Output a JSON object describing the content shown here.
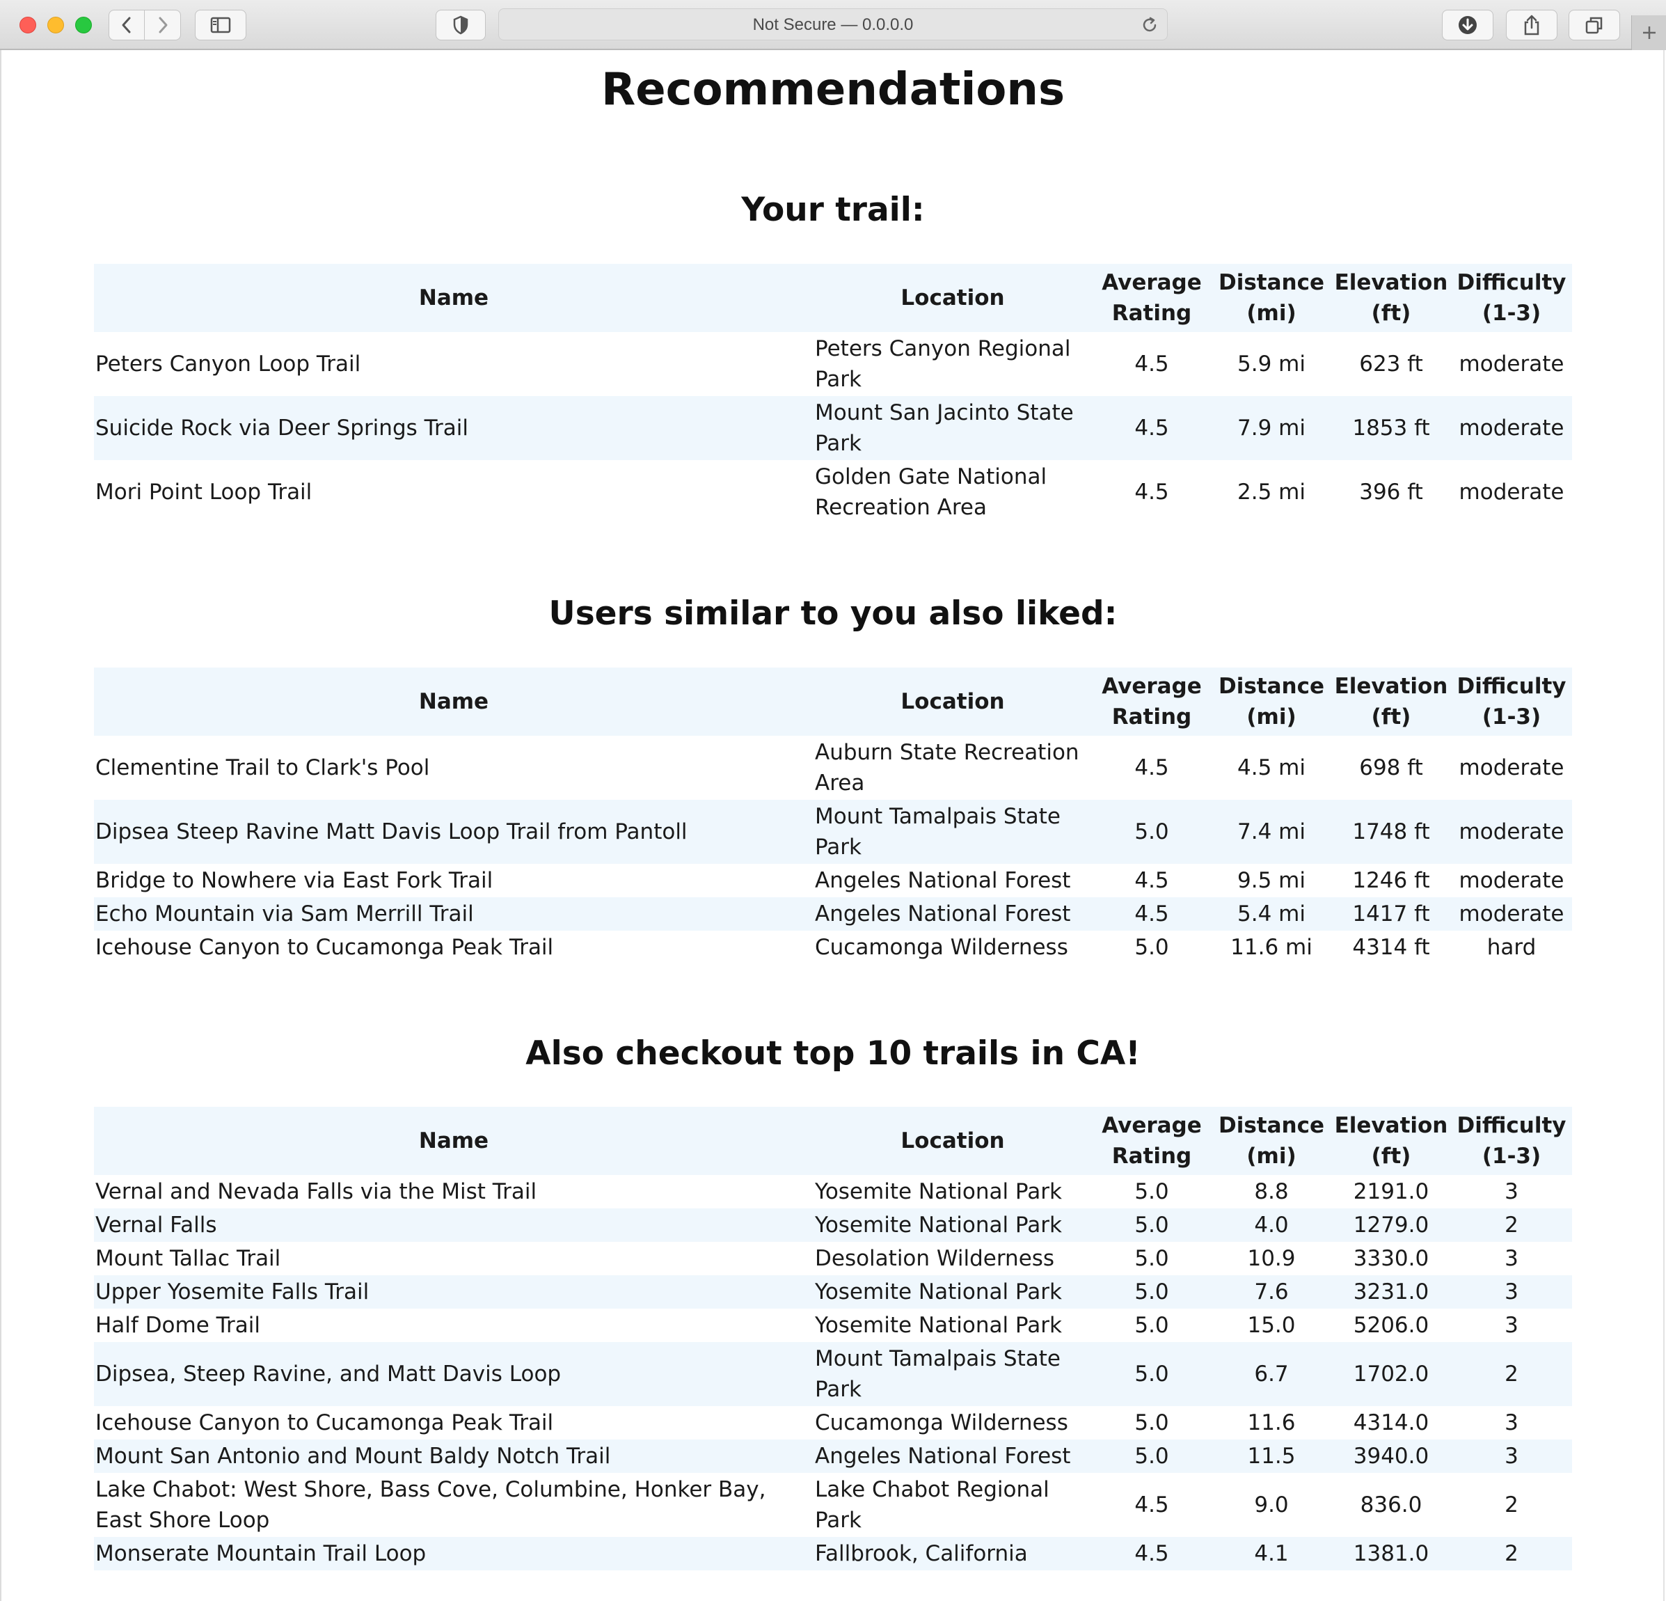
{
  "browser": {
    "address": "Not Secure — 0.0.0.0"
  },
  "page": {
    "title": "Recommendations"
  },
  "columns": [
    "Name",
    "Location",
    "Average Rating",
    "Distance (mi)",
    "Elevation (ft)",
    "Difficulty (1-3)"
  ],
  "your_trail": {
    "heading": "Your trail:",
    "rows": [
      {
        "name": "Peters Canyon Loop Trail",
        "location": "Peters Canyon Regional Park",
        "rating": "4.5",
        "distance": "5.9 mi",
        "elevation": "623 ft",
        "difficulty": "moderate"
      },
      {
        "name": "Suicide Rock via Deer Springs Trail",
        "location": "Mount San Jacinto State Park",
        "rating": "4.5",
        "distance": "7.9 mi",
        "elevation": "1853 ft",
        "difficulty": "moderate"
      },
      {
        "name": "Mori Point Loop Trail",
        "location": "Golden Gate National Recreation Area",
        "rating": "4.5",
        "distance": "2.5 mi",
        "elevation": "396 ft",
        "difficulty": "moderate"
      }
    ]
  },
  "similar_users": {
    "heading": "Users similar to you also liked:",
    "rows": [
      {
        "name": "Clementine Trail to Clark's Pool",
        "location": "Auburn State Recreation Area",
        "rating": "4.5",
        "distance": "4.5 mi",
        "elevation": "698 ft",
        "difficulty": "moderate"
      },
      {
        "name": "Dipsea Steep Ravine Matt Davis Loop Trail from Pantoll",
        "location": "Mount Tamalpais State Park",
        "rating": "5.0",
        "distance": "7.4 mi",
        "elevation": "1748 ft",
        "difficulty": "moderate"
      },
      {
        "name": "Bridge to Nowhere via East Fork Trail",
        "location": "Angeles National Forest",
        "rating": "4.5",
        "distance": "9.5 mi",
        "elevation": "1246 ft",
        "difficulty": "moderate"
      },
      {
        "name": "Echo Mountain via Sam Merrill Trail",
        "location": "Angeles National Forest",
        "rating": "4.5",
        "distance": "5.4 mi",
        "elevation": "1417 ft",
        "difficulty": "moderate"
      },
      {
        "name": "Icehouse Canyon to Cucamonga Peak Trail",
        "location": "Cucamonga Wilderness",
        "rating": "5.0",
        "distance": "11.6 mi",
        "elevation": "4314 ft",
        "difficulty": "hard"
      }
    ]
  },
  "top_ca": {
    "heading": "Also checkout top 10 trails in CA!",
    "rows": [
      {
        "name": "Vernal and Nevada Falls via the Mist Trail",
        "location": "Yosemite National Park",
        "rating": "5.0",
        "distance": "8.8",
        "elevation": "2191.0",
        "difficulty": "3"
      },
      {
        "name": "Vernal Falls",
        "location": "Yosemite National Park",
        "rating": "5.0",
        "distance": "4.0",
        "elevation": "1279.0",
        "difficulty": "2"
      },
      {
        "name": "Mount Tallac Trail",
        "location": "Desolation Wilderness",
        "rating": "5.0",
        "distance": "10.9",
        "elevation": "3330.0",
        "difficulty": "3"
      },
      {
        "name": "Upper Yosemite Falls Trail",
        "location": "Yosemite National Park",
        "rating": "5.0",
        "distance": "7.6",
        "elevation": "3231.0",
        "difficulty": "3"
      },
      {
        "name": "Half Dome Trail",
        "location": "Yosemite National Park",
        "rating": "5.0",
        "distance": "15.0",
        "elevation": "5206.0",
        "difficulty": "3"
      },
      {
        "name": "Dipsea, Steep Ravine, and Matt Davis Loop",
        "location": "Mount Tamalpais State Park",
        "rating": "5.0",
        "distance": "6.7",
        "elevation": "1702.0",
        "difficulty": "2"
      },
      {
        "name": "Icehouse Canyon to Cucamonga Peak Trail",
        "location": "Cucamonga Wilderness",
        "rating": "5.0",
        "distance": "11.6",
        "elevation": "4314.0",
        "difficulty": "3"
      },
      {
        "name": "Mount San Antonio and Mount Baldy Notch Trail",
        "location": "Angeles National Forest",
        "rating": "5.0",
        "distance": "11.5",
        "elevation": "3940.0",
        "difficulty": "3"
      },
      {
        "name": "Lake Chabot: West Shore, Bass Cove, Columbine, Honker Bay, East Shore Loop",
        "location": "Lake Chabot Regional Park",
        "rating": "4.5",
        "distance": "9.0",
        "elevation": "836.0",
        "difficulty": "2"
      },
      {
        "name": "Monserate Mountain Trail Loop",
        "location": "Fallbrook, California",
        "rating": "4.5",
        "distance": "4.1",
        "elevation": "1381.0",
        "difficulty": "2"
      }
    ]
  }
}
